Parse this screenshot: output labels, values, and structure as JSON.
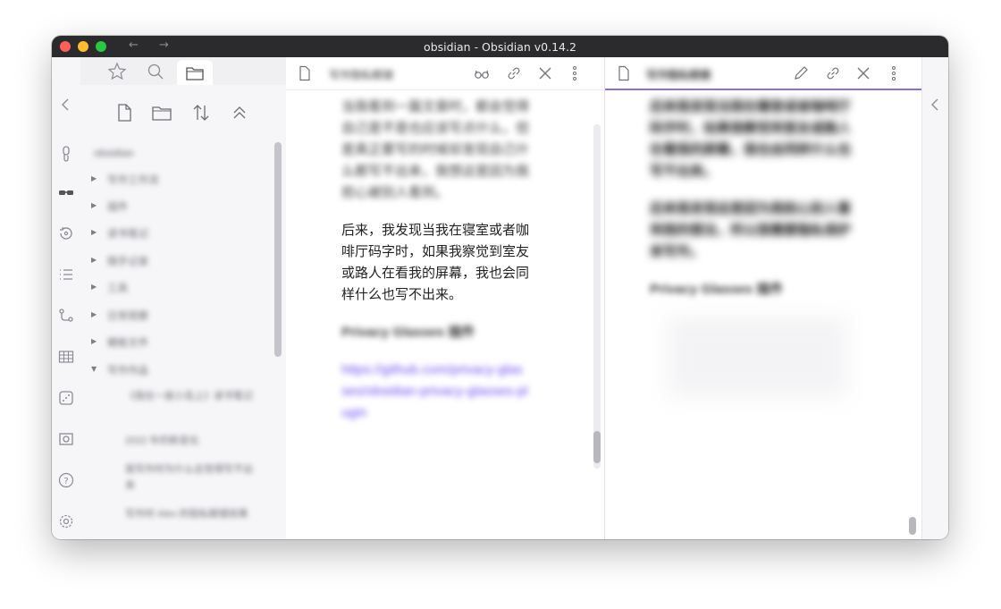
{
  "window": {
    "title": "obsidian - Obsidian v0.14.2",
    "back_glyph": "←",
    "forward_glyph": "→"
  },
  "ribbon": {
    "icons": [
      "chevron-left-icon",
      "link-icon",
      "glasses-icon",
      "history-icon",
      "list-icon",
      "graph-icon",
      "table-icon",
      "dice-icon",
      "screenshot-icon",
      "help-icon",
      "settings-icon"
    ]
  },
  "sidebar": {
    "tabs": [
      "star-icon",
      "search-icon",
      "folder-icon"
    ],
    "tools": [
      "new-note-icon",
      "new-folder-icon",
      "sort-icon",
      "collapse-icon"
    ],
    "vault_name": "obsidian",
    "tree": [
      {
        "label": "写作工作流",
        "expanded": false
      },
      {
        "label": "插件",
        "expanded": false
      },
      {
        "label": "读书笔记",
        "expanded": false
      },
      {
        "label": "随手记录",
        "expanded": false
      },
      {
        "label": "工具",
        "expanded": false
      },
      {
        "label": "日常观察",
        "expanded": false
      },
      {
        "label": "模板文件",
        "expanded": false
      },
      {
        "label": "写作作品",
        "expanded": true
      }
    ],
    "children": [
      "《我在一座小岛上》读书笔记",
      "2022 年的新变化",
      "我写作时为什么总觉得写不出来",
      "写作时 Alex 的隐私眼镜效果"
    ]
  },
  "pane1": {
    "title": "写作隐私眼镜",
    "blur_para_1": "当我看到一篇文章时，都会觉得自己是不是也应该写点什么，但是真正要写的时候却发现自己什么都写不出来，我想这是因为我担心被别人看到。",
    "visible_para": "后来，我发现当我在寝室或者咖啡厅码字时，如果我察觉到室友或路人在看我的屏幕，我也会同样什么也写不出来。",
    "blur_heading": "Privacy Glasses 插件",
    "blur_link": "https://github.com/privacy-glasses/obsidian-privacy-glasses-plugin"
  },
  "pane2": {
    "title": "写作隐私眼镜",
    "heavy_para_1": "后来我发现当我在寝室或者咖啡厅码字时，如果我察觉到室友或路人在看我的屏幕，我也会同样什么也写不出来。",
    "heavy_para_2": "后来我发现这是因为我担心别人看到我的想法，所以我需要隐私保护来写作。",
    "blur_heading": "Privacy Glasses 插件"
  }
}
